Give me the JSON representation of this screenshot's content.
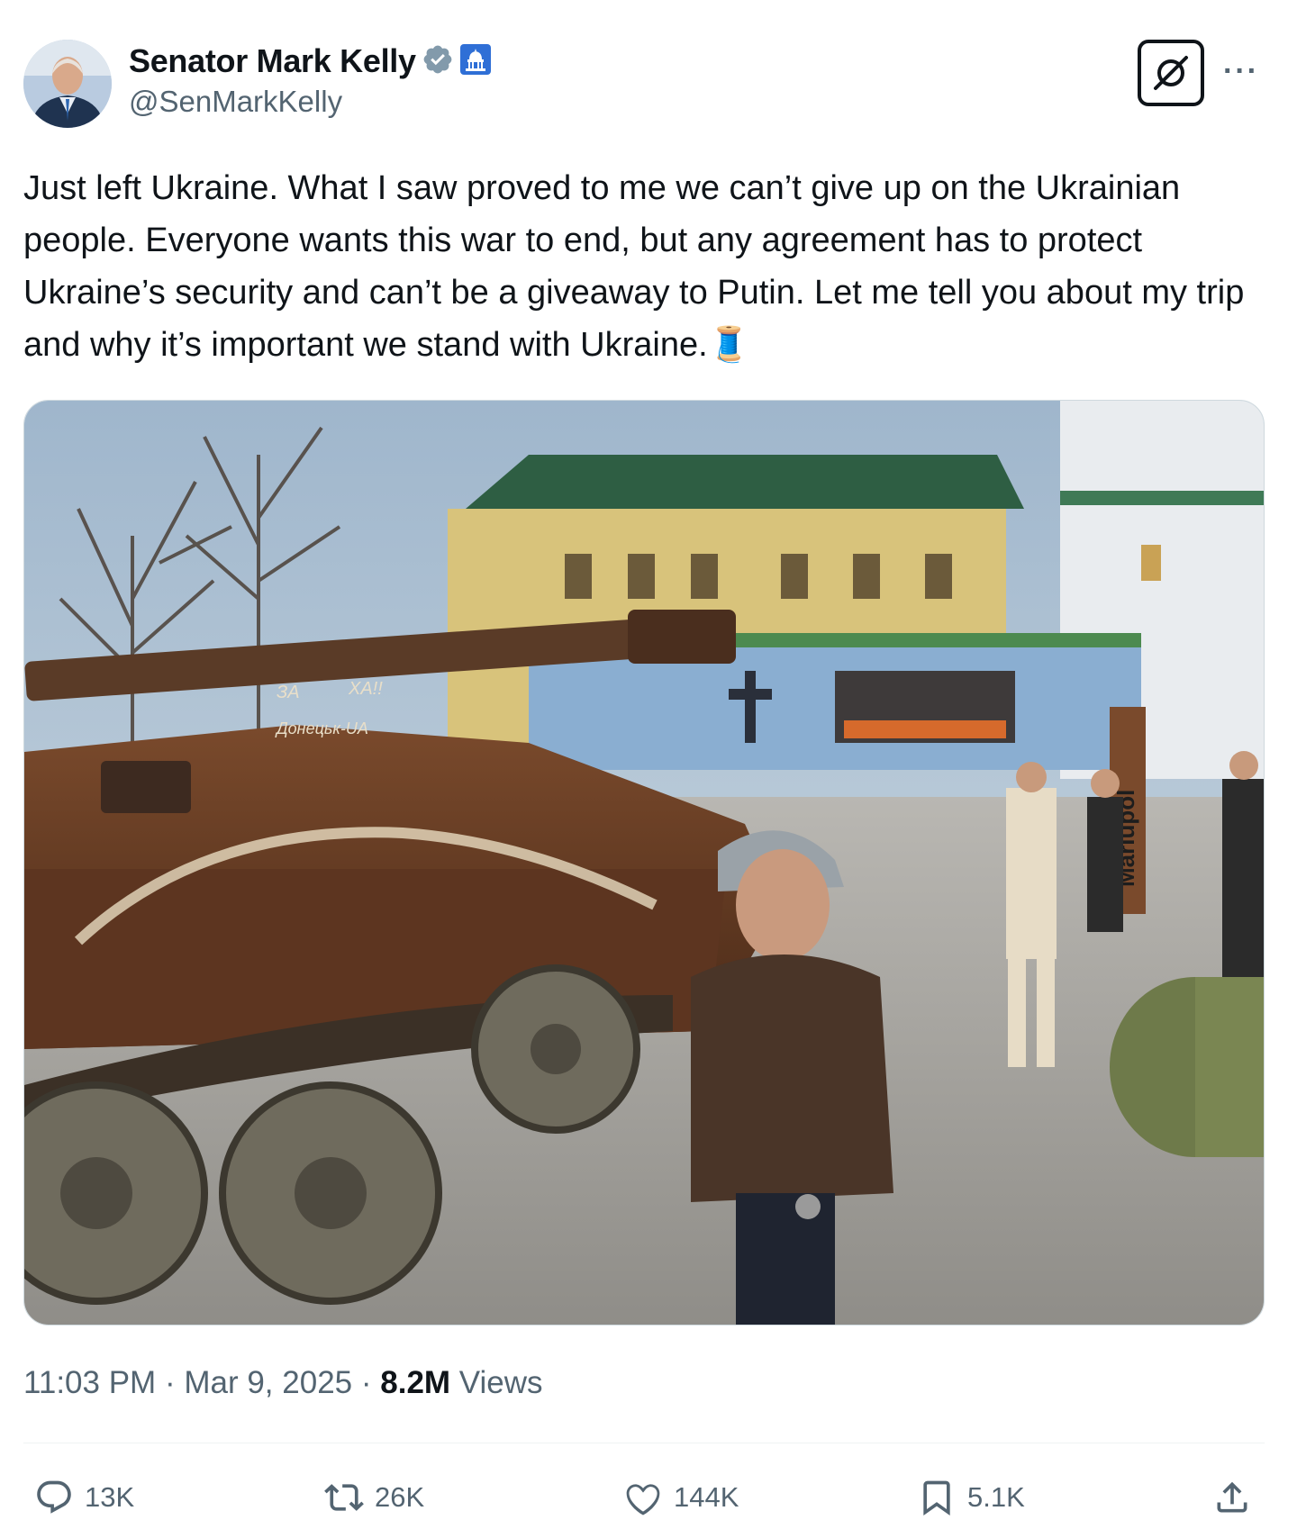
{
  "author": {
    "name": "Senator Mark Kelly",
    "handle": "@SenMarkKelly"
  },
  "tweet": {
    "text": "Just left Ukraine. What I saw proved to me we can’t give up on the Ukrainian people. Everyone wants this war to end, but any agreement has to protect Ukraine’s security and can’t be a giveaway to Putin. Let me tell you about my trip and why it’s important we stand with Ukraine.🧵"
  },
  "media": {
    "tank_markings": [
      "ЗА",
      "ХА!!",
      "Донецьк-UA"
    ],
    "sign_text": "Mariupol"
  },
  "meta": {
    "time": "11:03 PM",
    "separator": "·",
    "date": "Mar 9, 2025",
    "views_count": "8.2M",
    "views_label": "Views"
  },
  "actions": {
    "replies": "13K",
    "reposts": "26K",
    "likes": "144K",
    "bookmarks": "5.1K"
  },
  "colors": {
    "text": "#0f1419",
    "secondary": "#536471",
    "verified": "#829aab",
    "divider": "#eff3f4"
  }
}
